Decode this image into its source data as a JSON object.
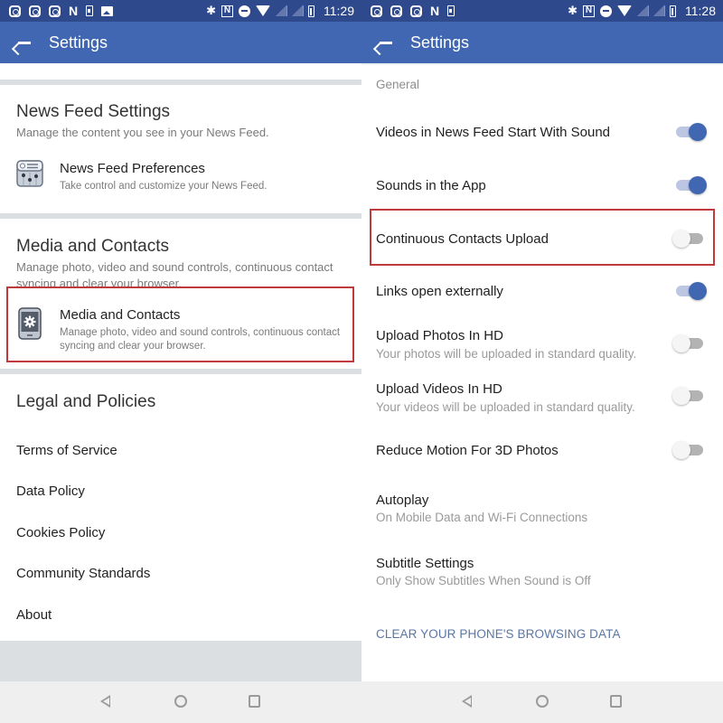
{
  "left_screen": {
    "status_bar": {
      "notification_icons": [
        "instagram-icon",
        "instagram-icon",
        "instagram-icon",
        "netflix-icon",
        "download-icon",
        "gallery-icon"
      ],
      "system_icons": [
        "bluetooth-icon",
        "nfc-icon",
        "do-not-disturb-icon",
        "wifi-icon",
        "signal-icon",
        "signal-icon",
        "battery-charging-icon"
      ],
      "netflix_glyph": "N",
      "bluetooth_glyph": "✱",
      "nfc_glyph": "N",
      "time": "11:29"
    },
    "app_bar": {
      "title": "Settings",
      "back_icon": "arrow-left-icon"
    },
    "sections": [
      {
        "title": "News Feed Settings",
        "subtitle": "Manage the content you see in your News Feed.",
        "items": [
          {
            "icon": "news-feed-preferences-icon",
            "label": "News Feed Preferences",
            "description": "Take control and customize your News Feed."
          }
        ]
      },
      {
        "title": "Media and Contacts",
        "subtitle": "Manage photo, video and sound controls, continuous contact syncing and clear your browser.",
        "items": [
          {
            "icon": "phone-settings-icon",
            "label": "Media and Contacts",
            "description": "Manage photo, video and sound controls, continuous contact syncing and clear your browser.",
            "highlighted": true
          }
        ]
      },
      {
        "title": "Legal and Policies",
        "links": [
          "Terms of Service",
          "Data Policy",
          "Cookies Policy",
          "Community Standards",
          "About"
        ]
      }
    ],
    "highlight_color": "#c0393b"
  },
  "right_screen": {
    "status_bar": {
      "notification_icons": [
        "instagram-icon",
        "instagram-icon",
        "instagram-icon",
        "netflix-icon",
        "download-icon"
      ],
      "system_icons": [
        "bluetooth-icon",
        "nfc-icon",
        "do-not-disturb-icon",
        "wifi-icon",
        "signal-icon",
        "signal-icon",
        "battery-charging-icon"
      ],
      "netflix_glyph": "N",
      "bluetooth_glyph": "✱",
      "nfc_glyph": "N",
      "time": "11:28"
    },
    "app_bar": {
      "title": "Settings",
      "back_icon": "arrow-left-icon"
    },
    "group_label": "General",
    "settings": [
      {
        "label": "Videos in News Feed Start With Sound",
        "toggle": true
      },
      {
        "label": "Sounds in the App",
        "toggle": true
      },
      {
        "label": "Continuous Contacts Upload",
        "toggle": false,
        "highlighted": true
      },
      {
        "label": "Links open externally",
        "toggle": true
      },
      {
        "label": "Upload Photos In HD",
        "description": "Your photos will be uploaded in standard quality.",
        "toggle": false
      },
      {
        "label": "Upload Videos In HD",
        "description": "Your videos will be uploaded in standard quality.",
        "toggle": false
      },
      {
        "label": "Reduce Motion For 3D Photos",
        "toggle": false
      },
      {
        "label": "Autoplay",
        "description": "On Mobile Data and Wi-Fi Connections"
      },
      {
        "label": "Subtitle Settings",
        "description": "Only Show Subtitles When Sound is Off"
      }
    ],
    "clear_link": "CLEAR YOUR PHONE'S BROWSING DATA"
  },
  "nav_bar": {
    "buttons": [
      "back-nav-icon",
      "home-nav-icon",
      "recents-nav-icon"
    ]
  },
  "colors": {
    "status_bar": "#2f4a8c",
    "app_bar": "#4267b2",
    "toggle_on": "#4267b2",
    "toggle_on_track": "#bcc6e2",
    "toggle_off_track": "#b3b3b3",
    "link": "#5a77a6",
    "highlight": "#c0393b"
  }
}
